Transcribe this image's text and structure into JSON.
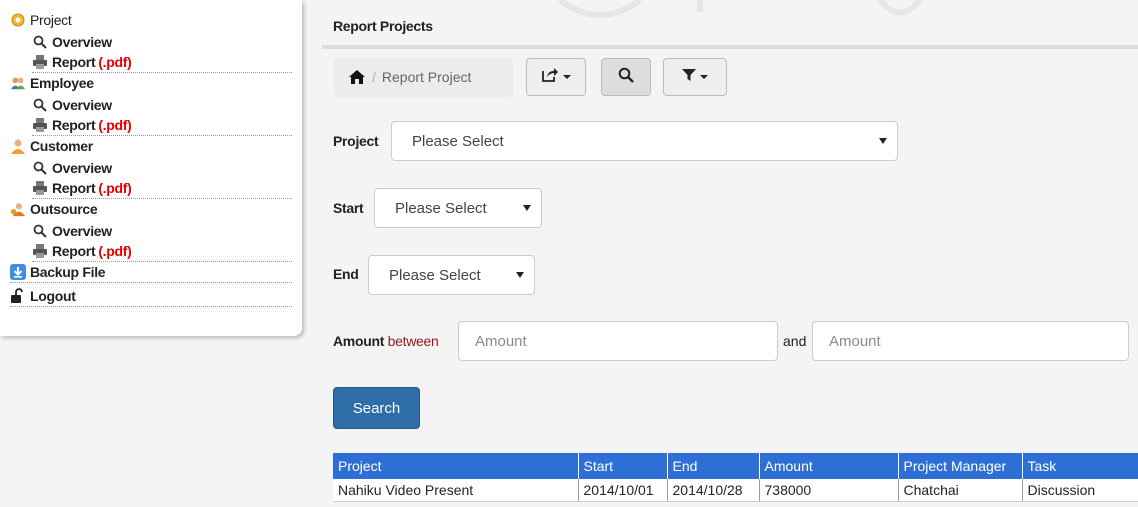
{
  "sidebar": {
    "items": [
      {
        "label": "Project",
        "icon": "gear-icon"
      },
      {
        "label": "Overview",
        "icon": "search-icon"
      },
      {
        "label": "Report",
        "pdf": "(.pdf)",
        "icon": "printer-icon"
      },
      {
        "label": "Employee",
        "icon": "users-icon"
      },
      {
        "label": "Overview",
        "icon": "search-icon"
      },
      {
        "label": "Report",
        "pdf": "(.pdf)",
        "icon": "printer-icon"
      },
      {
        "label": "Customer",
        "icon": "user-icon"
      },
      {
        "label": "Overview",
        "icon": "search-icon"
      },
      {
        "label": "Report",
        "pdf": "(.pdf)",
        "icon": "printer-icon"
      },
      {
        "label": "Outsource",
        "icon": "outsource-icon"
      },
      {
        "label": "Overview",
        "icon": "search-icon"
      },
      {
        "label": "Report",
        "pdf": "(.pdf)",
        "icon": "printer-icon"
      },
      {
        "label": "Backup File",
        "icon": "download-icon"
      },
      {
        "label": "Logout",
        "icon": "unlock-icon"
      }
    ]
  },
  "main": {
    "title": "Report Projects",
    "breadcrumb": {
      "separator": "/",
      "current": "Report Project"
    },
    "toolbar": {
      "share_icon": "share-icon",
      "search_icon": "search-icon",
      "filter_icon": "filter-icon"
    },
    "form": {
      "project_label": "Project",
      "project_value": "Please Select",
      "start_label": "Start",
      "start_value": "Please Select",
      "end_label": "End",
      "end_value": "Please Select",
      "amount_label": "Amount",
      "amount_between": "between",
      "amount_from_placeholder": "Amount",
      "and_label": "and",
      "amount_to_placeholder": "Amount",
      "search_label": "Search"
    },
    "table": {
      "headers": [
        "Project",
        "Start",
        "End",
        "Amount",
        "Project Manager",
        "Task"
      ],
      "rows": [
        [
          "Nahiku Video Present",
          "2014/10/01",
          "2014/10/28",
          "738000",
          "Chatchai",
          "Discussion"
        ]
      ]
    }
  },
  "colors": {
    "accent": "#2e6fd6",
    "button": "#2f6da8",
    "pdf": "#e60000"
  }
}
